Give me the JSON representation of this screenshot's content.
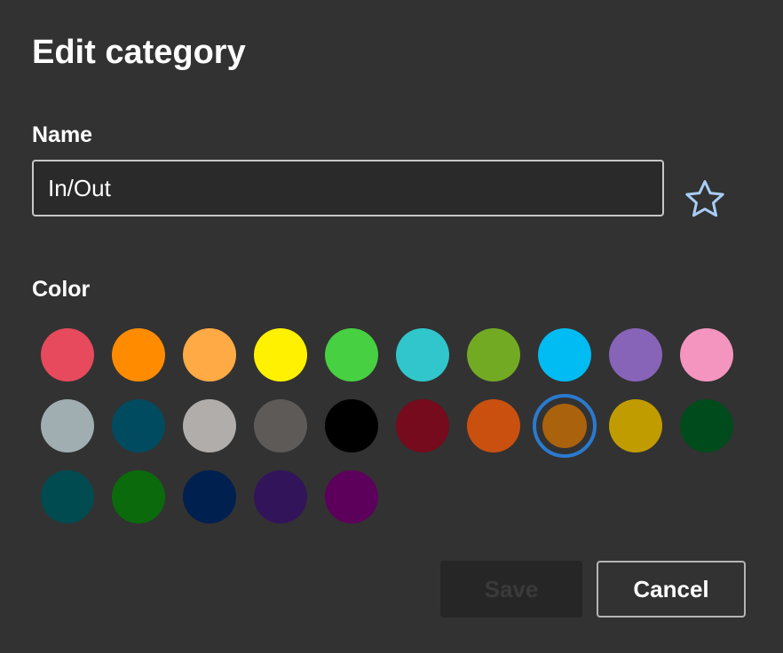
{
  "dialog": {
    "title": "Edit category"
  },
  "name": {
    "label": "Name",
    "value": "In/Out",
    "favorite_icon": "star-outline-icon",
    "favorite_color": "#a8cdf5"
  },
  "color": {
    "label": "Color",
    "selected_index": 17,
    "swatches": [
      "#e64a5c",
      "#ff8c00",
      "#ffaa44",
      "#fff100",
      "#47d041",
      "#30c6cc",
      "#73aa24",
      "#00bcf2",
      "#8764b8",
      "#f495bf",
      "#a0aeb2",
      "#004b60",
      "#b1adab",
      "#5d5a58",
      "#000000",
      "#750b1c",
      "#ca5010",
      "#ab620d",
      "#c19c00",
      "#004b1c",
      "#004b50",
      "#0b6a0b",
      "#002050",
      "#32145a",
      "#5c005c"
    ]
  },
  "footer": {
    "save_label": "Save",
    "cancel_label": "Cancel"
  }
}
